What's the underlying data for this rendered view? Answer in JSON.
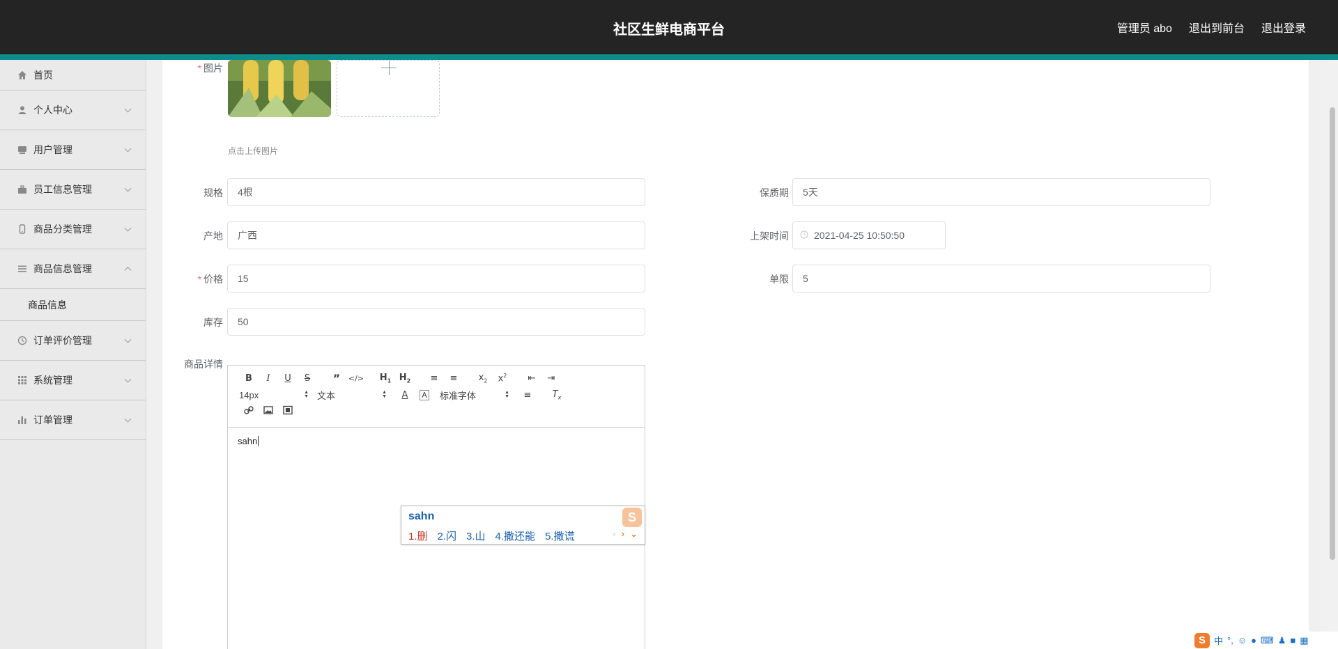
{
  "header": {
    "title": "社区生鲜电商平台",
    "admin_label": "管理员 abo",
    "front_label": "退出到前台",
    "logout_label": "退出登录"
  },
  "sidebar": {
    "items": [
      {
        "label": "首页",
        "icon": "home-icon"
      },
      {
        "label": "个人中心",
        "icon": "user-icon"
      },
      {
        "label": "用户管理",
        "icon": "users-icon"
      },
      {
        "label": "员工信息管理",
        "icon": "briefcase-icon"
      },
      {
        "label": "商品分类管理",
        "icon": "mobile-icon"
      },
      {
        "label": "商品信息管理",
        "icon": "list-icon"
      },
      {
        "label": "订单评价管理",
        "icon": "clock-icon"
      },
      {
        "label": "系统管理",
        "icon": "grid-icon"
      },
      {
        "label": "订单管理",
        "icon": "chart-icon"
      }
    ],
    "sub_item": "商品信息"
  },
  "form": {
    "image_label": "图片",
    "upload_tip": "点击上传图片",
    "spec_label": "规格",
    "spec_value": "4根",
    "shelf_life_label": "保质期",
    "shelf_life_value": "5天",
    "origin_label": "产地",
    "origin_value": "广西",
    "listing_time_label": "上架时间",
    "listing_time_value": "2021-04-25 10:50:50",
    "price_label": "价格",
    "price_value": "15",
    "limit_label": "单限",
    "limit_value": "5",
    "stock_label": "库存",
    "stock_value": "50",
    "detail_label": "商品详情"
  },
  "editor": {
    "font_size": "14px",
    "block_type": "文本",
    "font_family": "标准字体",
    "content": "sahn"
  },
  "ime": {
    "pinyin": "sahn",
    "candidates": [
      "1.删",
      "2.闪",
      "3.山",
      "4.撒还能",
      "5.撒谎"
    ]
  },
  "tray": {
    "lang": "中",
    "punct": "°,"
  },
  "colors": {
    "header_bg": "#242424",
    "accent": "#0e8c8c",
    "required": "#f56c6c"
  }
}
